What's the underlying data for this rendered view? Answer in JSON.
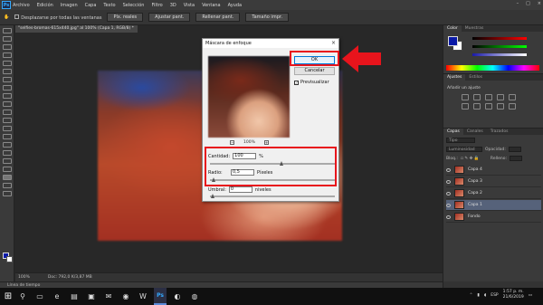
{
  "menubar": {
    "items": [
      "Archivo",
      "Edición",
      "Imagen",
      "Capa",
      "Texto",
      "Selección",
      "Filtro",
      "3D",
      "Vista",
      "Ventana",
      "Ayuda"
    ],
    "logo": "Ps"
  },
  "options_bar": {
    "checkbox_label": "Desplazarse por todas las ventanas",
    "buttons": [
      "Píx. reales",
      "Ajustar pant.",
      "Rellenar pant.",
      "Tamaño impr."
    ]
  },
  "document_tab": "\"selfies-bromas-615x440.jpg\" al 100% (Capa 1, RGB/8) *",
  "status_bar": {
    "zoom": "100%",
    "doc_info": "Doc: 792,0 K/3,87 MB"
  },
  "timeline_tab": "Línea de tiempo",
  "right_panel": {
    "color_tabs": [
      "Color",
      "Muestras"
    ],
    "adjust_tabs": [
      "Ajustes",
      "Estilos"
    ],
    "adjust_title": "Añadir un ajuste",
    "layer_tabs": [
      "Capas",
      "Canales",
      "Trazados"
    ],
    "kind_label": "Tipo",
    "mode_label": "Luminosidad",
    "opacity_label": "Opacidad:",
    "lock_label": "Bloq.:",
    "fill_label": "Relleno:",
    "layers": [
      {
        "name": "Capa 4",
        "selected": false
      },
      {
        "name": "Capa 3",
        "selected": false
      },
      {
        "name": "Capa 2",
        "selected": false
      },
      {
        "name": "Capa 1",
        "selected": true
      },
      {
        "name": "Fondo",
        "selected": false
      }
    ]
  },
  "dialog": {
    "title": "Máscara de enfoque",
    "close": "×",
    "ok_label": "OK",
    "cancel_label": "Cancelar",
    "preview_label": "Previsualizar",
    "preview_checked": true,
    "zoom": "100%",
    "cantidad_label": "Cantidad:",
    "cantidad_value": "100",
    "cantidad_unit": "%",
    "radio_label": "Radio:",
    "radio_value": "0,5",
    "radio_unit": "Píxeles",
    "umbral_label": "Umbral:",
    "umbral_value": "0",
    "umbral_unit": "niveles"
  },
  "taskbar": {
    "tray_lang": "ESP",
    "time": "1:57 p. m.",
    "date": "21/6/2019"
  },
  "colors": {
    "highlight": "#e8141c",
    "foreground": "#0a1aa8",
    "background": "#ffffff",
    "selected_layer": "#56627a"
  }
}
